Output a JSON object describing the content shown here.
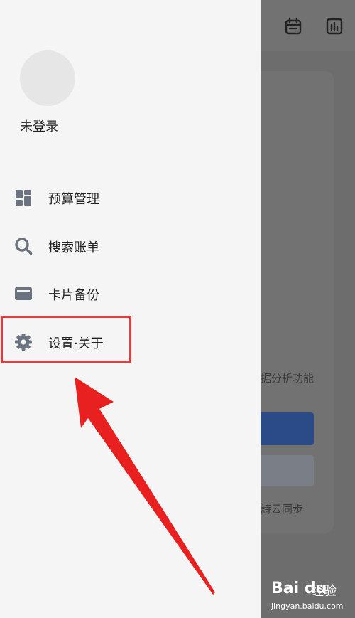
{
  "background_app": {
    "header_icons": [
      "calendar-icon",
      "bar-chart-icon"
    ],
    "card_text_1": "据分析功能",
    "card_text_2": "詩云同步"
  },
  "drawer": {
    "login_status": "未登录",
    "menu": [
      {
        "label": "预算管理",
        "icon": "dashboard-grid-icon"
      },
      {
        "label": "搜索账单",
        "icon": "search-icon"
      },
      {
        "label": "卡片备份",
        "icon": "card-icon"
      },
      {
        "label": "设置·关于",
        "icon": "gear-icon"
      }
    ]
  },
  "watermark": {
    "logo": "Bai du",
    "suffix": "经验",
    "url": "jingyan.baidu.com"
  },
  "colors": {
    "drawer_bg": "#f5f5f5",
    "icon_gray": "#6b7380",
    "annotation_red": "#e23c3c",
    "primary_blue": "#2a4b87"
  }
}
